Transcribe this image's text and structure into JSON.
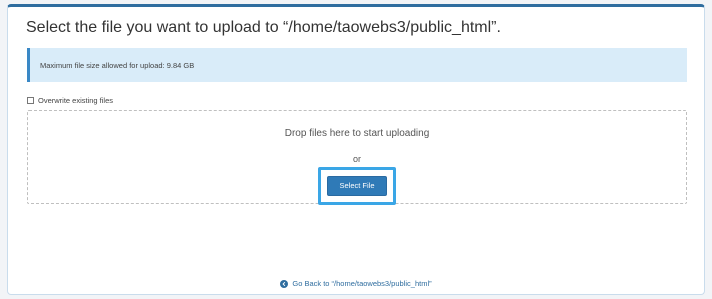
{
  "page": {
    "title": "Select the file you want to upload to “/home/taowebs3/public_html”."
  },
  "info": {
    "max_size_text": "Maximum file size allowed for upload: 9.84 GB"
  },
  "options": {
    "overwrite_label": "Overwrite existing files",
    "overwrite_checked": false
  },
  "dropzone": {
    "drop_text": "Drop files here to start uploading",
    "or_text": "or",
    "select_button_label": "Select File"
  },
  "footer": {
    "back_link_text": "Go Back to “/home/taowebs3/public_html”",
    "back_icon": "arrow-left-circle-icon"
  },
  "colors": {
    "accent": "#2f7ab7",
    "info_bg": "#d9ecf9",
    "highlight": "#3aa6e6"
  }
}
